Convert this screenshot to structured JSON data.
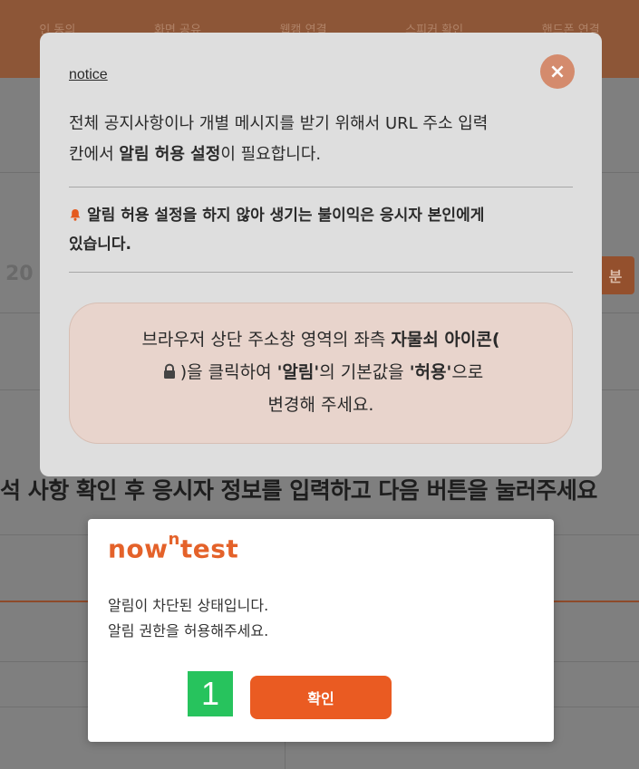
{
  "background": {
    "steps": [
      "인 동의",
      "화면 공유",
      "웹캠 연결",
      "스피커 확인",
      "핸드폰 연결"
    ],
    "left_number": "20",
    "right_badge": "분",
    "instruction": "석 사항 확인 후 응시자 정보를 입력하고 다음 버튼을 눌러주세요"
  },
  "notice": {
    "title": "notice",
    "close_label": "×",
    "line1": "전체 공지사항이나 개별 메시지를 받기 위해서 URL 주소 입력",
    "line2_pre": "칸에서 ",
    "line2_bold": "알림 허용 설정",
    "line2_post": "이 필요합니다.",
    "warning_line1": "알림 허용 설정을 하지 않아 생기는 불이익은 응시자 본인에게",
    "warning_line2": "있습니다.",
    "guide_line1_pre": "브라우저 상단 주소창 영역의 좌측 ",
    "guide_line1_bold": "자물쇠 아이콘(",
    "guide_line2_pre": ")을 클릭하여 ",
    "guide_line2_bold1": "'알림'",
    "guide_line2_mid": "의 기본값을 ",
    "guide_line2_bold2": "'허용'",
    "guide_line2_post": "으로",
    "guide_line3": "변경해 주세요."
  },
  "alert": {
    "brand_pre": "now",
    "brand_sup": "n",
    "brand_post": "test",
    "message_line1": "알림이 차단된 상태입니다.",
    "message_line2": "알림 권한을 허용해주세요.",
    "step_badge": "1",
    "confirm_label": "확인"
  },
  "colors": {
    "accent": "#ea5b22",
    "brand": "#e4622a",
    "badge_green": "#27c35d",
    "warning_bell": "#e45a1f"
  }
}
